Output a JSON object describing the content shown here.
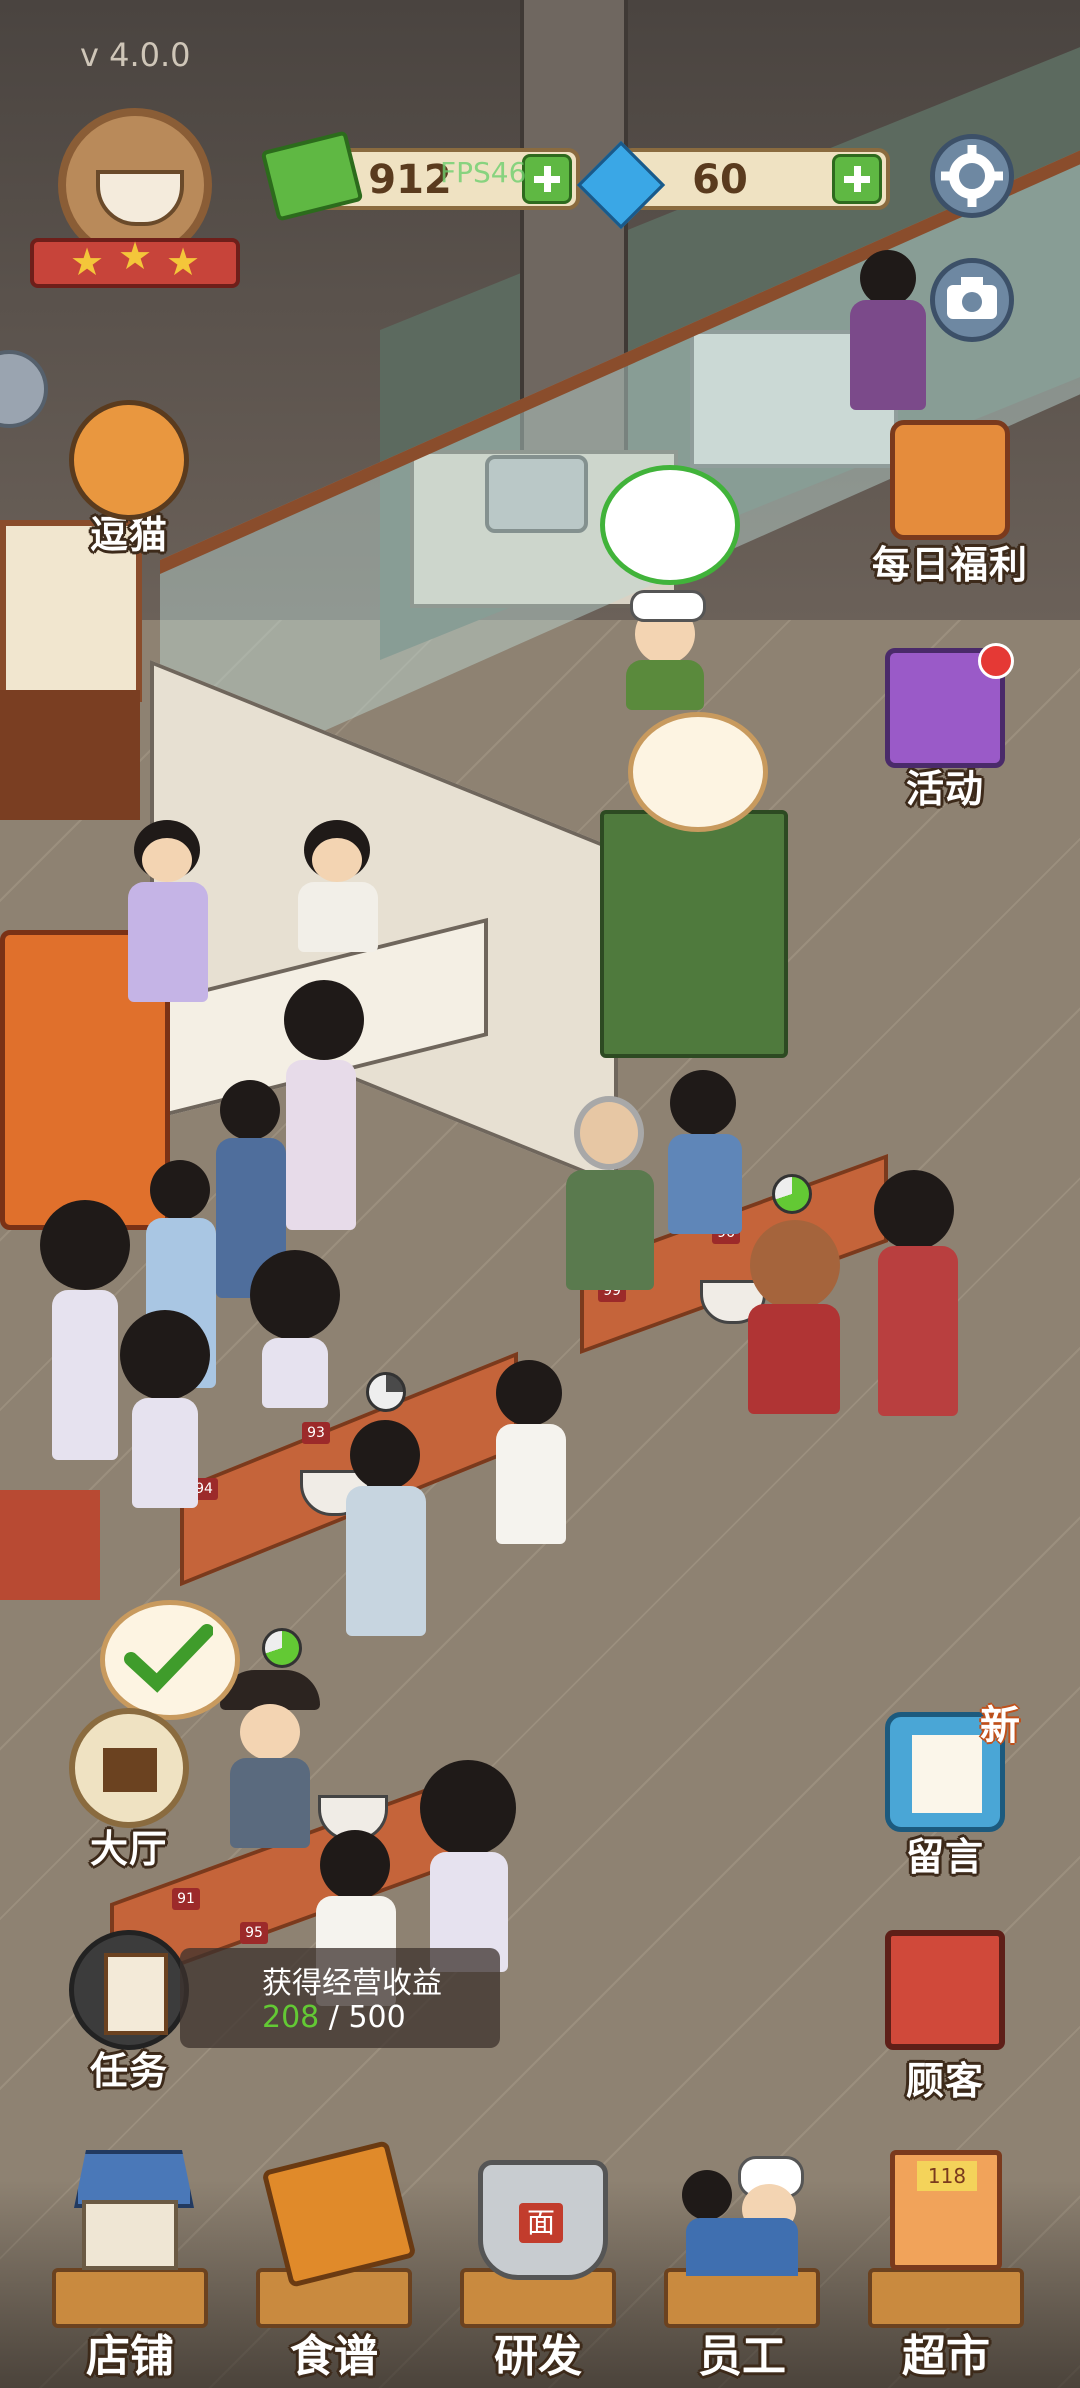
{
  "version": "v 4.0.0",
  "fps_overlay": "FPS46",
  "currency": {
    "cash": "912",
    "gems": "60"
  },
  "side_left": {
    "cat": "逗猫",
    "hall": "大厅",
    "task": "任务"
  },
  "side_right": {
    "daily": "每日福利",
    "activity": "活动",
    "message": "留言",
    "message_badge": "新",
    "customer": "顾客"
  },
  "task_progress": {
    "title": "获得经营收益",
    "current": "208",
    "separator": " / ",
    "total": "500"
  },
  "bottom_nav": {
    "shop": "店铺",
    "recipe": "食谱",
    "research": "研发",
    "staff": "员工",
    "market": "超市"
  },
  "seat_tags": [
    "99",
    "96",
    "93",
    "94",
    "91",
    "95"
  ],
  "market_sign": "118",
  "pot_label": "面",
  "colors": {
    "accent_green": "#5fb843",
    "text_outline": "#3d2a1a",
    "progress_green": "#63c934"
  }
}
